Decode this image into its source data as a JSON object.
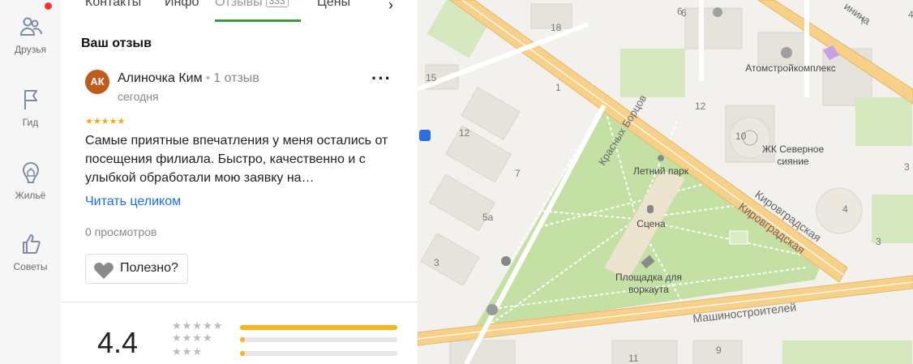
{
  "rail": {
    "items": [
      {
        "label": "Друзья",
        "icon": "friends-icon"
      },
      {
        "label": "Гид",
        "icon": "flag-icon"
      },
      {
        "label": "Жильё",
        "icon": "housing-icon"
      },
      {
        "label": "Советы",
        "icon": "thumbs-up-icon"
      }
    ],
    "notification_color": "#ff3333"
  },
  "tabs": {
    "items": [
      "Контакты",
      "Инфо",
      "Отзывы",
      "Цены"
    ],
    "active": "Отзывы",
    "reviews_count": "333"
  },
  "review": {
    "section_title": "Ваш отзыв",
    "avatar_initials": "АК",
    "author": "Алиночка Ким",
    "author_reviews": "1 отзыв",
    "date": "сегодня",
    "stars": 5,
    "text": "Самые приятные впечатления у меня остались от посещения филиала. Быстро, качественно и с улыбкой обработали мою заявку на…",
    "read_more": "Читать целиком",
    "views": "0 просмотров",
    "useful_label": "Полезно?"
  },
  "summary": {
    "rating": "4.4",
    "distribution": [
      {
        "stars": 5,
        "share": 1.0
      },
      {
        "stars": 4,
        "share": 0.03
      },
      {
        "stars": 3,
        "share": 0.03
      }
    ]
  },
  "map": {
    "labels": {
      "street1": "Красных Борцов",
      "street2": "Кировградская",
      "street3": "Кировградская",
      "street4": "Машиностроителей",
      "street5": "инина",
      "park": "Летний парк",
      "stage": "Сцена",
      "workout": "Площадка для",
      "workout2": "воркаута",
      "poi1": "Атомстройкомплекс",
      "poi2": "ЖК Северное",
      "poi3": "сияние"
    },
    "house_numbers": [
      "6",
      "18",
      "15",
      "1",
      "12",
      "12",
      "10",
      "7",
      "5а",
      "3",
      "4",
      "3",
      "11",
      "9",
      "7",
      "4",
      "3",
      "6"
    ],
    "colors": {
      "park": "#c5e0a5",
      "road": "#f7d08a",
      "block": "#ebe9e4",
      "bg": "#f3f1ed"
    }
  }
}
